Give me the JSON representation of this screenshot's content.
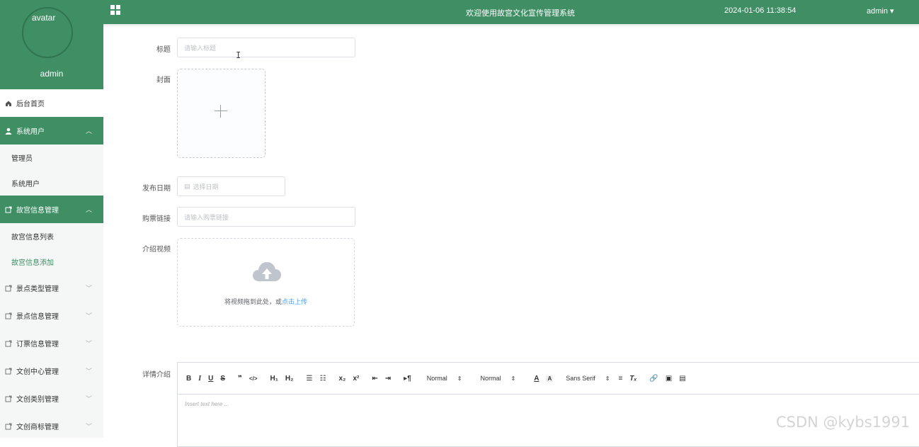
{
  "header": {
    "title": "欢迎使用故宫文化宣传管理系统",
    "datetime": "2024-01-06 11:38:54",
    "user_menu": "admin ▾",
    "menu_icon": "grid-icon"
  },
  "profile": {
    "avatar_alt": "avatar",
    "name": "admin"
  },
  "sidebar": {
    "home": {
      "label": "后台首页",
      "icon": "home-icon"
    },
    "groups": [
      {
        "label": "系统用户",
        "icon": "user-icon",
        "expanded": true,
        "children": [
          "管理员",
          "系统用户"
        ]
      },
      {
        "label": "故宫信息管理",
        "icon": "folder-icon",
        "expanded": true,
        "children": [
          "故宫信息列表",
          "故宫信息添加"
        ],
        "current": "故宫信息添加"
      },
      {
        "label": "景点类型管理",
        "icon": "folder-icon"
      },
      {
        "label": "景点信息管理",
        "icon": "folder-icon"
      },
      {
        "label": "订票信息管理",
        "icon": "folder-icon"
      },
      {
        "label": "文创中心管理",
        "icon": "folder-icon"
      },
      {
        "label": "文创类别管理",
        "icon": "folder-icon"
      },
      {
        "label": "文创商标管理",
        "icon": "folder-icon"
      }
    ],
    "accent_color": "#3f8e64"
  },
  "form": {
    "title": {
      "label": "标题",
      "placeholder": "请输入标题"
    },
    "cover": {
      "label": "封面"
    },
    "publish_date": {
      "label": "发布日期",
      "placeholder": "选择日期"
    },
    "ticket_link": {
      "label": "购票链接",
      "placeholder": "请输入购票链接"
    },
    "video": {
      "label": "介绍视频",
      "hint": "将视频拖到此处，或",
      "link": "点击上传"
    },
    "detail": {
      "label": "详情介绍"
    }
  },
  "editor": {
    "buttons": [
      "B",
      "I",
      "U",
      "S",
      "99",
      "</>",
      "H1",
      "H2",
      "ol",
      "ul",
      "x2",
      "x2",
      "outdent",
      "indent",
      "rtl"
    ],
    "header_select": "Normal",
    "size_select": "Normal",
    "font_select": "Sans Serif",
    "placeholder": "Insert text here ..."
  },
  "watermark": "CSDN @kybs1991"
}
